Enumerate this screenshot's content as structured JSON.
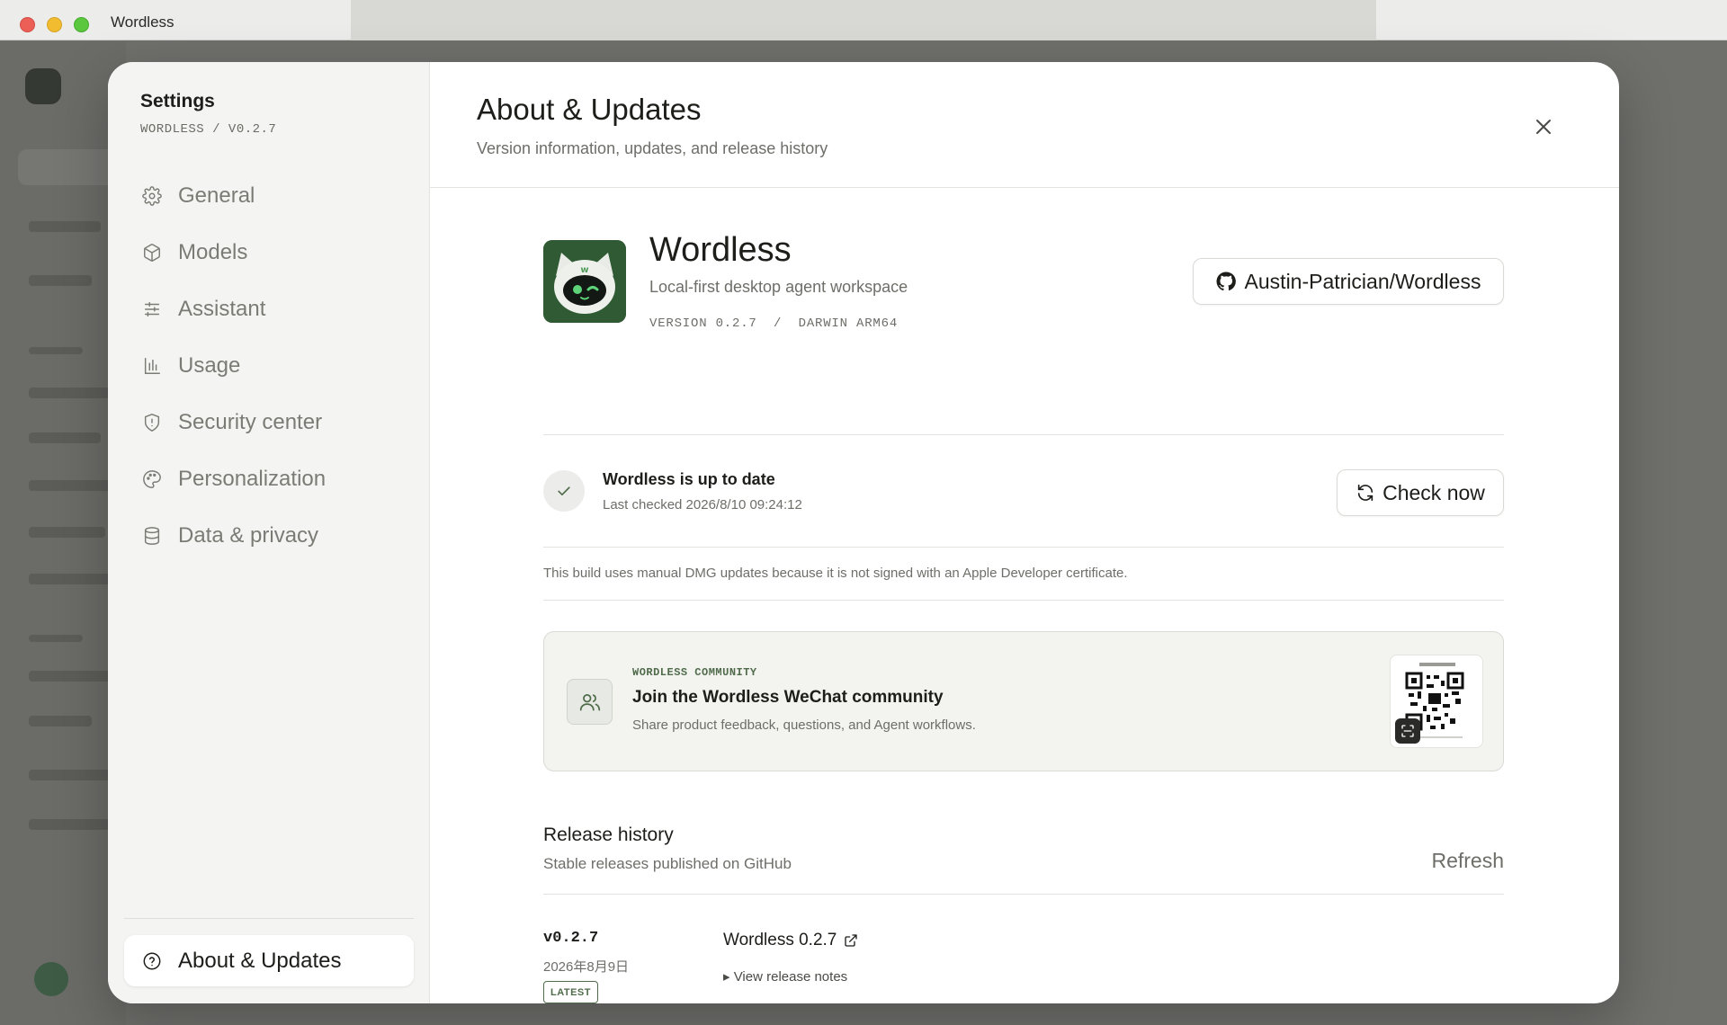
{
  "window": {
    "title": "Wordless"
  },
  "sidebar": {
    "title": "Settings",
    "subtitle": "WORDLESS / V0.2.7",
    "items": [
      {
        "label": "General",
        "icon": "gear-icon"
      },
      {
        "label": "Models",
        "icon": "cube-icon"
      },
      {
        "label": "Assistant",
        "icon": "sliders-icon"
      },
      {
        "label": "Usage",
        "icon": "bar-chart-icon"
      },
      {
        "label": "Security center",
        "icon": "shield-icon"
      },
      {
        "label": "Personalization",
        "icon": "palette-icon"
      },
      {
        "label": "Data & privacy",
        "icon": "database-icon"
      }
    ],
    "active_item": {
      "label": "About & Updates",
      "icon": "help-circle-icon"
    }
  },
  "header": {
    "title": "About & Updates",
    "subtitle": "Version information, updates, and release history"
  },
  "app": {
    "name": "Wordless",
    "description": "Local-first desktop agent workspace",
    "version_line": "VERSION 0.2.7  /  DARWIN ARM64",
    "repo_label": "Austin-Patrician/Wordless"
  },
  "update_status": {
    "title": "Wordless is up to date",
    "last_checked": "Last checked 2026/8/10 09:24:12",
    "check_button": "Check now"
  },
  "build_note": "This build uses manual DMG updates because it is not signed with an Apple Developer certificate.",
  "community": {
    "eyebrow": "WORDLESS COMMUNITY",
    "title": "Join the Wordless WeChat community",
    "subtitle": "Share product feedback, questions, and Agent workflows."
  },
  "release_history": {
    "title": "Release history",
    "subtitle": "Stable releases published on GitHub",
    "refresh_label": "Refresh",
    "releases": [
      {
        "tag": "v0.2.7",
        "date": "2026年8月9日",
        "badge": "LATEST",
        "name": "Wordless 0.2.7",
        "notes_label": "▸ View release notes"
      }
    ]
  },
  "colors": {
    "accent": "#4f6b4a",
    "brand_icon_bg": "#2f5a33",
    "sidebar_bg": "#f4f4f2"
  }
}
